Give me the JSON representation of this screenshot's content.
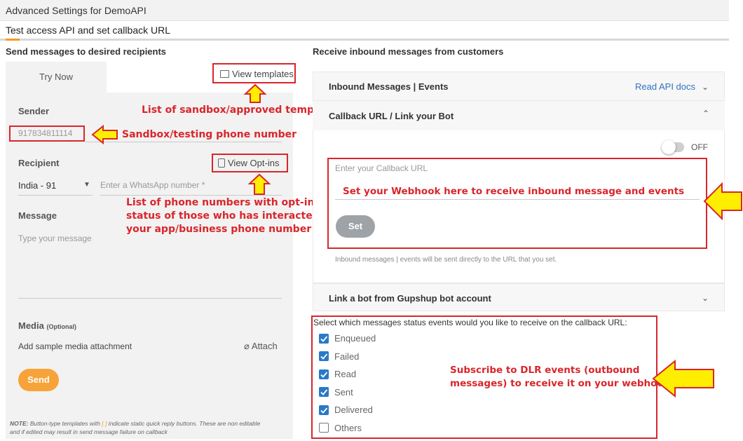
{
  "header": {
    "title": "Advanced Settings for DemoAPI",
    "subtitle": "Test access API and set callback URL"
  },
  "left": {
    "section_title": "Send messages to desired recipients",
    "try_now_tab": "Try Now",
    "view_templates": "View templates",
    "sender_label": "Sender",
    "sender_value": "917834811114",
    "recipient_label": "Recipient",
    "view_optins": "View Opt-ins",
    "country_value": "India - 91",
    "phone_placeholder": "Enter a WhatsApp number *",
    "message_label": "Message",
    "message_placeholder": "Type your message",
    "media_label": "Media",
    "media_optional": "(Optional)",
    "media_sample": "Add sample media attachment",
    "attach_label": "Attach",
    "send_label": "Send",
    "note_prefix": "NOTE:",
    "note_text_a": " Button-type templates with ",
    "note_brackets": "[ ]",
    "note_text_b": " indicate static quick reply buttons. These are non editable",
    "note_text_c": "and if edited may result in send message failure on callback"
  },
  "right": {
    "section_title": "Receive inbound messages from customers",
    "inbound_title": "Inbound Messages | Events",
    "read_docs": "Read API docs",
    "callback_title": "Callback URL / Link your Bot",
    "toggle_label": "OFF",
    "callback_placeholder": "Enter your Callback URL",
    "set_label": "Set",
    "callback_hint": "Inbound messages | events will be sent directly to the URL that you set.",
    "bot_title": "Link a bot from Gupshup bot account",
    "events_question": "Select which messages status events would you like to receive on the callback URL:",
    "events": [
      {
        "label": "Enqueued",
        "checked": true
      },
      {
        "label": "Failed",
        "checked": true
      },
      {
        "label": "Read",
        "checked": true
      },
      {
        "label": "Sent",
        "checked": true
      },
      {
        "label": "Delivered",
        "checked": true
      },
      {
        "label": "Others",
        "checked": false
      }
    ]
  },
  "annotations": {
    "templates": "List of sandbox/approved templates",
    "sandbox": "Sandbox/testing phone number",
    "optins_1": "List of phone numbers with opt-in",
    "optins_2": "status of those who has interacted with",
    "optins_3": "your app/business phone number",
    "webhook": "Set your Webhook here to receive inbound message and events",
    "dlr_1": "Subscribe to DLR events (outbound",
    "dlr_2": "messages) to receive it on your webhook"
  },
  "colors": {
    "accent": "#f59a23",
    "annotation_red": "#d9262c",
    "arrow_yellow": "#ffee00",
    "checkbox_blue": "#2979c8"
  }
}
